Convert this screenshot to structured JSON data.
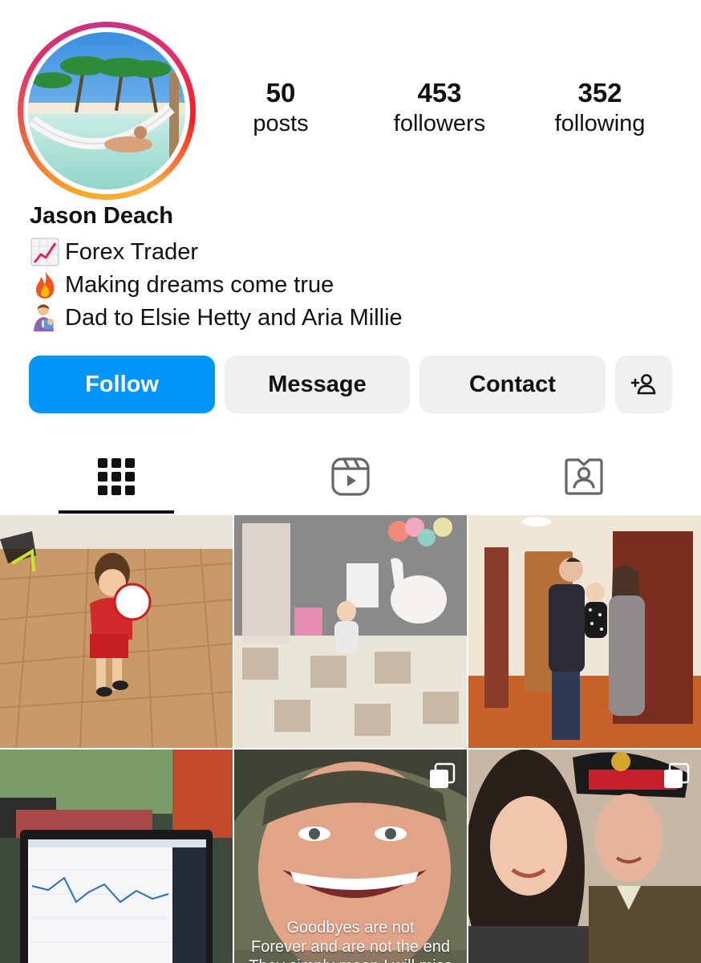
{
  "profile": {
    "name": "Jason Deach",
    "avatar": "hammock-on-beach-photo"
  },
  "stats": [
    {
      "value": "50",
      "label": "posts"
    },
    {
      "value": "453",
      "label": "followers"
    },
    {
      "value": "352",
      "label": "following"
    }
  ],
  "bio": [
    {
      "emoji": "chart-increasing-emoji",
      "text": "Forex Trader"
    },
    {
      "emoji": "fire-emoji",
      "text": "Making dreams come true"
    },
    {
      "emoji": "man-feeding-baby-emoji",
      "text": "Dad to Elsie Hetty and Aria Millie"
    }
  ],
  "actions": {
    "follow": "Follow",
    "message": "Message",
    "contact": "Contact",
    "add_icon": "add-person-icon"
  },
  "tabs": [
    {
      "icon": "grid-icon",
      "active": true
    },
    {
      "icon": "reels-icon",
      "active": false
    },
    {
      "icon": "tagged-icon",
      "active": false
    }
  ],
  "posts": [
    {
      "subject": "toddler-with-football",
      "multi": false
    },
    {
      "subject": "baby-birthday-setup",
      "multi": false
    },
    {
      "subject": "family-in-hallway",
      "multi": false
    },
    {
      "subject": "laptop-trading-chart",
      "multi": false
    },
    {
      "subject": "young-soldier-portrait",
      "multi": true,
      "caption_lines": [
        "Goodbyes are not",
        "Forever and are not the end",
        "They simply mean I will miss you"
      ]
    },
    {
      "subject": "couple-selfie-soldier",
      "multi": true
    }
  ],
  "colors": {
    "follow_blue": "#0095f6",
    "button_gray": "#efefef",
    "text": "#111111"
  }
}
